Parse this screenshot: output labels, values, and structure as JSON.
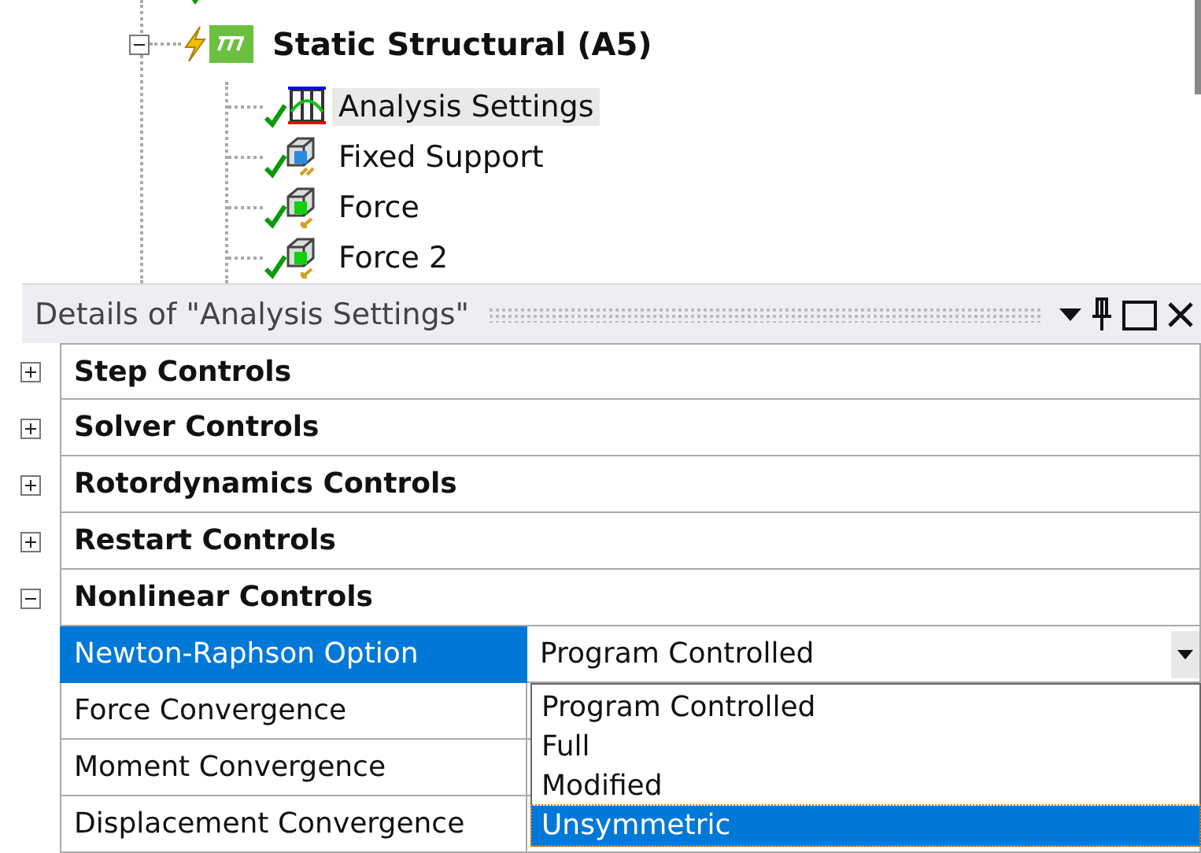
{
  "tree": {
    "label": "Static Structural (A5)",
    "expanded": true,
    "children": [
      {
        "label": "Analysis Settings",
        "selected": true,
        "kind": "settings"
      },
      {
        "label": "Fixed Support",
        "selected": false,
        "kind": "support"
      },
      {
        "label": "Force",
        "selected": false,
        "kind": "force"
      },
      {
        "label": "Force 2",
        "selected": false,
        "kind": "force"
      }
    ]
  },
  "details": {
    "title": "Details of \"Analysis Settings\"",
    "groups": [
      {
        "label": "Step Controls",
        "expanded": false
      },
      {
        "label": "Solver Controls",
        "expanded": false
      },
      {
        "label": "Rotordynamics Controls",
        "expanded": false
      },
      {
        "label": "Restart Controls",
        "expanded": false
      },
      {
        "label": "Nonlinear Controls",
        "expanded": true,
        "properties": [
          {
            "label": "Newton-Raphson Option",
            "value": "Program Controlled",
            "selected": true
          },
          {
            "label": "Force Convergence",
            "selected": false
          },
          {
            "label": "Moment Convergence",
            "selected": false
          },
          {
            "label": "Displacement Convergence",
            "selected": false
          }
        ]
      }
    ]
  },
  "dropdown": {
    "options": [
      {
        "label": "Program Controlled",
        "selected": false
      },
      {
        "label": "Full",
        "selected": false
      },
      {
        "label": "Modified",
        "selected": false
      },
      {
        "label": "Unsymmetric",
        "selected": true
      }
    ]
  }
}
